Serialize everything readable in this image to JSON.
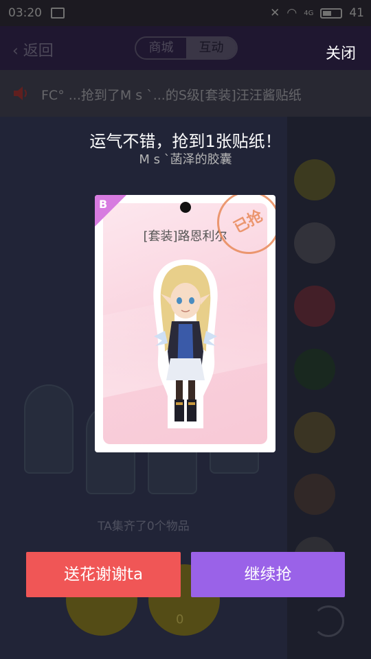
{
  "status_bar": {
    "time": "03:20",
    "network": "4G",
    "battery": "41"
  },
  "header": {
    "back_label": "返回",
    "tabs": [
      "商城",
      "互动"
    ],
    "active_tab": "互动",
    "close_label": "关闭"
  },
  "ticker": {
    "text": "FC°    ...抢到了M s `...的S级[套装]汪汪酱贴纸"
  },
  "background": {
    "collected_text": "TA集齐了0个物品",
    "count": "0"
  },
  "popup": {
    "headline": "运气不错，抢到1张贴纸！",
    "subline": "M s `菡泽的胶囊",
    "card": {
      "grade": "B",
      "name": "[套装]路恩利尔",
      "stamp": "已抢"
    },
    "buttons": {
      "send_flower": "送花谢谢ta",
      "continue": "继续抢"
    }
  },
  "colors": {
    "send_flower": "#f05656",
    "continue": "#9a62e8",
    "card_corner": "#d77be0"
  }
}
